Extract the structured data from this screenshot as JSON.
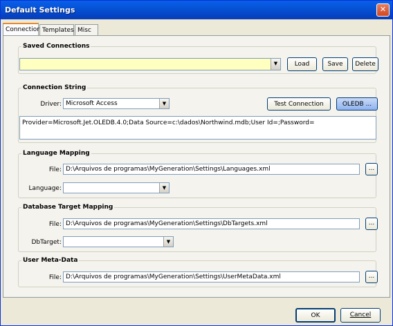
{
  "window": {
    "title": "Default Settings",
    "close_glyph": "✕"
  },
  "tabs": [
    {
      "label": "Connection"
    },
    {
      "label": "Templates"
    },
    {
      "label": "Misc"
    }
  ],
  "saved_connections": {
    "legend": "Saved Connections",
    "value": "",
    "load": "Load",
    "save": "Save",
    "delete": "Delete"
  },
  "connection_string": {
    "legend": "Connection String",
    "driver_label": "Driver:",
    "driver_value": "Microsoft Access",
    "test_button": "Test Connection",
    "oledb_button": "OLEDB ...",
    "value": "Provider=Microsoft.Jet.OLEDB.4.0;Data Source=c:\\dados\\Northwind.mdb;User Id=;Password="
  },
  "language_mapping": {
    "legend": "Language Mapping",
    "file_label": "File:",
    "file_value": "D:\\Arquivos de programas\\MyGeneration\\Settings\\Languages.xml",
    "browse": "...",
    "language_label": "Language:",
    "language_value": ""
  },
  "db_target_mapping": {
    "legend": "Database Target Mapping",
    "file_label": "File:",
    "file_value": "D:\\Arquivos de programas\\MyGeneration\\Settings\\DbTargets.xml",
    "browse": "...",
    "dbtarget_label": "DbTarget:",
    "dbtarget_value": ""
  },
  "user_meta_data": {
    "legend": "User Meta-Data",
    "file_label": "File:",
    "file_value": "D:\\Arquivos de programas\\MyGeneration\\Settings\\UserMetaData.xml",
    "browse": "..."
  },
  "footer": {
    "ok": "OK",
    "cancel": "Cancel"
  }
}
